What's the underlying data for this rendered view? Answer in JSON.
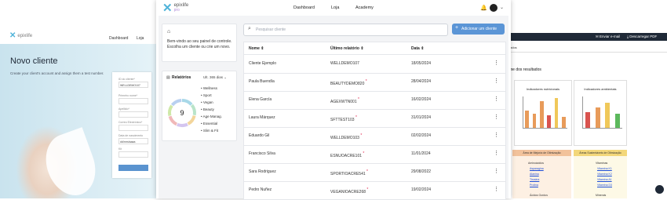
{
  "left_app": {
    "logo": {
      "name": "epixlife",
      "sub": "pro"
    },
    "nav": [
      "Dashboard",
      "Loja"
    ],
    "title": "Novo cliente",
    "subtitle": "Create your client's account and assign them a test number.",
    "form": {
      "fields": [
        {
          "label": "ID do cliente*",
          "value": "WELLDEMO107"
        },
        {
          "label": "Primeiro nome*",
          "value": ""
        },
        {
          "label": "Apellido*",
          "value": ""
        },
        {
          "label": "Correo Electrónico*",
          "value": ""
        },
        {
          "label": "Data de nascimento",
          "value": "dd/mm/aaaa"
        },
        {
          "label": "Kit",
          "value": ""
        }
      ]
    }
  },
  "main_app": {
    "logo": {
      "name": "epixlife",
      "sub": "pro"
    },
    "nav": {
      "dashboard": "Dashboard",
      "loja": "Loja",
      "academy": "Academy"
    },
    "welcome_text": "Bem-vindo ao seu painel de controle. Escolha um cliente ou crie um novo.",
    "reports": {
      "title": "Relatórios",
      "period": "Ult. 365 dias",
      "total": "9",
      "legend": [
        "Wellness",
        "Sport",
        "Vegan",
        "Beauty",
        "Age Manag.",
        "Essential",
        "Slim & Fit"
      ]
    },
    "search": {
      "placeholder": "Pesquisar cliente"
    },
    "add_button": "Adicionar um cliente",
    "table": {
      "headers": {
        "name": "Nome",
        "last_report": "Último relatório",
        "date": "Data"
      },
      "rows": [
        {
          "name": "Cliente Ejemplo",
          "report": "WELLDEMO107",
          "date": "18/05/2024",
          "flag": false
        },
        {
          "name": "Paula Buendía",
          "report": "BEAUTYDEMO820",
          "date": "28/04/2024",
          "flag": true
        },
        {
          "name": "Elena García",
          "report": "AGEXWTN001",
          "date": "16/02/2024",
          "flag": true
        },
        {
          "name": "Laura Márquez",
          "report": "SFTTEST103",
          "date": "31/01/2024",
          "flag": true
        },
        {
          "name": "Eduardo Gil",
          "report": "WELLDEMO103",
          "date": "02/02/2024",
          "flag": true
        },
        {
          "name": "Francisco Silva",
          "report": "ESNUOACRE101",
          "date": "11/01/2024",
          "flag": true
        },
        {
          "name": "Sara Rodriguez",
          "report": "SPORTIOACRE541",
          "date": "29/08/2022",
          "flag": true
        },
        {
          "name": "Pedro Nuñez",
          "report": "VEGANIOACRE268",
          "date": "19/02/2024",
          "flag": true
        }
      ]
    }
  },
  "right_app": {
    "actions": {
      "email": "Enviar e-mail",
      "pdf": "Descarregar PDF"
    },
    "tab": "ltados",
    "section_title": "me dos resultados",
    "chart1": {
      "title": "Indicadores nutricionais",
      "values": [
        0.55,
        0.45,
        0.85,
        0.4,
        0.95,
        0.35
      ]
    },
    "chart2": {
      "title": "Indicadores ambientais",
      "values": [
        0.5,
        0.65,
        0.8,
        0.45
      ]
    },
    "table_orange": {
      "header": "Área de Mejoría de Otimização",
      "title": "Aminoácidos",
      "items": [
        "Asparagina",
        "Alanina",
        "Tirosina",
        "Prolina"
      ]
    },
    "table_yellow": {
      "header": "Áreas Sustentáveis de Otimização",
      "title": "Vitaminas",
      "items": [
        "Vitamina K1",
        "Vitamina K2",
        "Vitamina A1",
        "Vitamina D3"
      ],
      "footer": "Minerais"
    },
    "bottom_left": "Ácidos Gordos",
    "colors": {
      "orange": "#e89b5a",
      "yellow": "#f0c85a",
      "red": "#d9534f",
      "green": "#5cb85c"
    }
  },
  "ring_colors": [
    "#a8d8e8",
    "#b9e4c9",
    "#f3d59b",
    "#d4c5ef",
    "#f0b8b8",
    "#cfe8a8",
    "#b8d0f0"
  ]
}
